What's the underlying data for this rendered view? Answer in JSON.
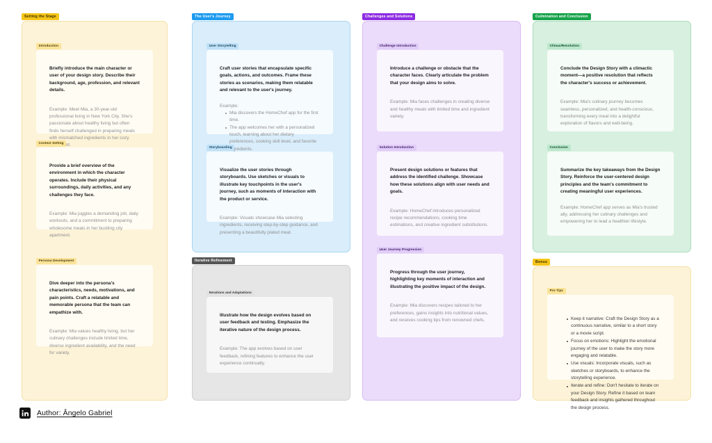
{
  "board": {
    "background": "#ffffff",
    "author_label": "Author: Ângelo Gabriel",
    "linkedin_icon": "linkedin-icon"
  },
  "frames": [
    {
      "id": "setting-the-stage",
      "tag": "Setting the Stage",
      "tag_bg": "#f5c518",
      "tag_color": "#3d2f00",
      "body_bg": "#fdf3d8",
      "body_border": "#f3e0a8",
      "cards": [
        {
          "id": "introduction",
          "tag": "Introduction",
          "tag_bg": "#fbe49a",
          "tag_color": "#4a3a06",
          "body_bg": "#fffcf3",
          "main": "Briefly introduce the main character or user of your design story. Describe their background, age, profession, and relevant details.",
          "example": "Example: Meet Mia, a 30-year-old professional living in New York City. She's passionate about healthy living but often finds herself challenged in preparing meals with mismatched ingredients in her cozy apartment."
        },
        {
          "id": "context-setting",
          "tag": "Context Setting",
          "tag_bg": "#fbe49a",
          "tag_color": "#4a3a06",
          "body_bg": "#fffcf3",
          "main": "Provide a brief overview of the environment in which the character operates. Include their physical surroundings, daily activities, and any challenges they face.",
          "example": "Example: Mia juggles a demanding job, daily workouts, and a commitment to preparing wholesome meals in her bustling city apartment."
        },
        {
          "id": "persona-development",
          "tag": "Persona Development",
          "tag_bg": "#fbe49a",
          "tag_color": "#4a3a06",
          "body_bg": "#fffcf3",
          "main": "Dive deeper into the persona's characteristics, needs, motivations, and pain points. Craft a relatable and memorable persona that the team can empathize with.",
          "example": "Example: Mia values healthy living, but her culinary challenges include limited time, diverse ingredient availability, and the need for variety."
        }
      ]
    },
    {
      "id": "the-users-journey",
      "tag": "The User's Journey",
      "tag_bg": "#1d9bf0",
      "tag_color": "#ffffff",
      "body_bg": "#d9edfb",
      "body_border": "#a9d4f0",
      "cards": [
        {
          "id": "user-storytelling",
          "tag": "User Storytelling",
          "tag_bg": "#bfe1f7",
          "tag_color": "#123c57",
          "body_bg": "#f6fbfe",
          "main": "Craft user stories that encapsulate specific goals, actions, and outcomes. Frame these stories as scenarios, making them relatable and relevant to the user's journey.",
          "example_lead": "Example:",
          "example_bullets": [
            "Mia discovers the HomeChef app for the first time.",
            "The app welcomes her with a personalized touch, learning about her dietary preferences, cooking skill level, and favorite ingredients."
          ]
        },
        {
          "id": "storyboarding",
          "tag": "Storyboarding",
          "tag_bg": "#bfe1f7",
          "tag_color": "#123c57",
          "body_bg": "#f6fbfe",
          "main": "Visualize the user stories through storyboards. Use sketches or visuals to illustrate key touchpoints in the user's journey, such as moments of interaction with the product or service.",
          "example": "Example: Visuals showcase Mia selecting ingredients, receiving step-by-step guidance, and presenting a beautifully plated meal."
        }
      ]
    },
    {
      "id": "iterative-refinement",
      "tag": "Iterative Refinement",
      "tag_bg": "#555555",
      "tag_color": "#ffffff",
      "body_bg": "#e6e6e6",
      "body_border": "#cfcfcf",
      "cards": [
        {
          "id": "iterations-and-adaptations",
          "tag": "Iterations and Adaptations",
          "tag_bg": "#e2e2e2",
          "tag_color": "#2b2b2b",
          "body_bg": "#f7f7f7",
          "main": "Illustrate how the design evolves based on user feedback and testing. Emphasize the iterative nature of the design process.",
          "example": "Example: The app evolves based on user feedback, refining features to enhance the user experience continually."
        }
      ]
    },
    {
      "id": "challenges-and-solutions",
      "tag": "Challenges and Solutions",
      "tag_bg": "#8e2de2",
      "tag_color": "#ffffff",
      "body_bg": "#ecdcfb",
      "body_border": "#d6b9f2",
      "cards": [
        {
          "id": "challenge-introduction",
          "tag": "Challenge Introduction",
          "tag_bg": "#e0cdf7",
          "tag_color": "#3a1163",
          "body_bg": "#faf6fe",
          "main": "Introduce a challenge or obstacle that the character faces. Clearly articulate the problem that your design aims to solve.",
          "example": "Example: Mia faces challenges in creating diverse and healthy meals with limited time and ingredient variety."
        },
        {
          "id": "solution-introduction",
          "tag": "Solution Introduction",
          "tag_bg": "#e0cdf7",
          "tag_color": "#3a1163",
          "body_bg": "#faf6fe",
          "main": "Present design solutions or features that address the identified challenge. Showcase how these solutions align with user needs and goals.",
          "example": "Example: HomeChef introduces personalized recipe recommendations, cooking time estimations, and creative ingredient substitutions."
        },
        {
          "id": "user-journey-progression",
          "tag": "User Journey Progression",
          "tag_bg": "#e0cdf7",
          "tag_color": "#3a1163",
          "body_bg": "#faf6fe",
          "main": "Progress through the user journey, highlighting key moments of interaction and illustrating the positive impact of the design.",
          "example": "Example: Mia discovers recipes tailored to her preferences, gains insights into nutritional values, and receives cooking tips from renowned chefs."
        }
      ]
    },
    {
      "id": "culmination-and-conclusion",
      "tag": "Culmination and Conclusion",
      "tag_bg": "#16a34a",
      "tag_color": "#ffffff",
      "body_bg": "#d8f0e0",
      "body_border": "#a8dcbc",
      "cards": [
        {
          "id": "climax-resolution",
          "tag": "Climax/Resolution",
          "tag_bg": "#bce8cd",
          "tag_color": "#0d4424",
          "body_bg": "#f6fcf8",
          "main": "Conclude the Design Story with a climactic moment—a positive resolution that reflects the character's success or achievement.",
          "example": "Example: Mia's culinary journey becomes seamless, personalized, and health-conscious, transforming every meal into a delightful exploration of flavors and well-being."
        },
        {
          "id": "conclusion",
          "tag": "Conclusion",
          "tag_bg": "#bce8cd",
          "tag_color": "#0d4424",
          "body_bg": "#f6fcf8",
          "main": "Summarize the key takeaways from the Design Story. Reinforce the user-centered design principles and the team's commitment to creating meaningful user experiences.",
          "example": "Example: HomeChef app serves as Mia's trusted ally, addressing her culinary challenges and empowering her to lead a healthier lifestyle."
        }
      ]
    },
    {
      "id": "bonus",
      "tag": "Bonus",
      "tag_bg": "#f5c518",
      "tag_color": "#3d2f00",
      "body_bg": "#fdf3d8",
      "body_border": "#f3e0a8",
      "cards": [
        {
          "id": "pro-tips",
          "tag": "Pro Tips",
          "tag_bg": "#fbe49a",
          "tag_color": "#4a3a06",
          "body_bg": "#fffcf3",
          "tips": [
            "Keep it narrative: Craft the Design Story as a continuous narrative, similar to a short story or a movie script.",
            "Focus on emotions: Highlight the emotional journey of the user to make the story more engaging and relatable.",
            "Use visuals: Incorporate visuals, such as sketches or storyboards, to enhance the storytelling experience.",
            "Iterate and refine: Don't hesitate to iterate on your Design Story. Refine it based on team feedback and insights gathered throughout the design process."
          ]
        }
      ]
    }
  ]
}
